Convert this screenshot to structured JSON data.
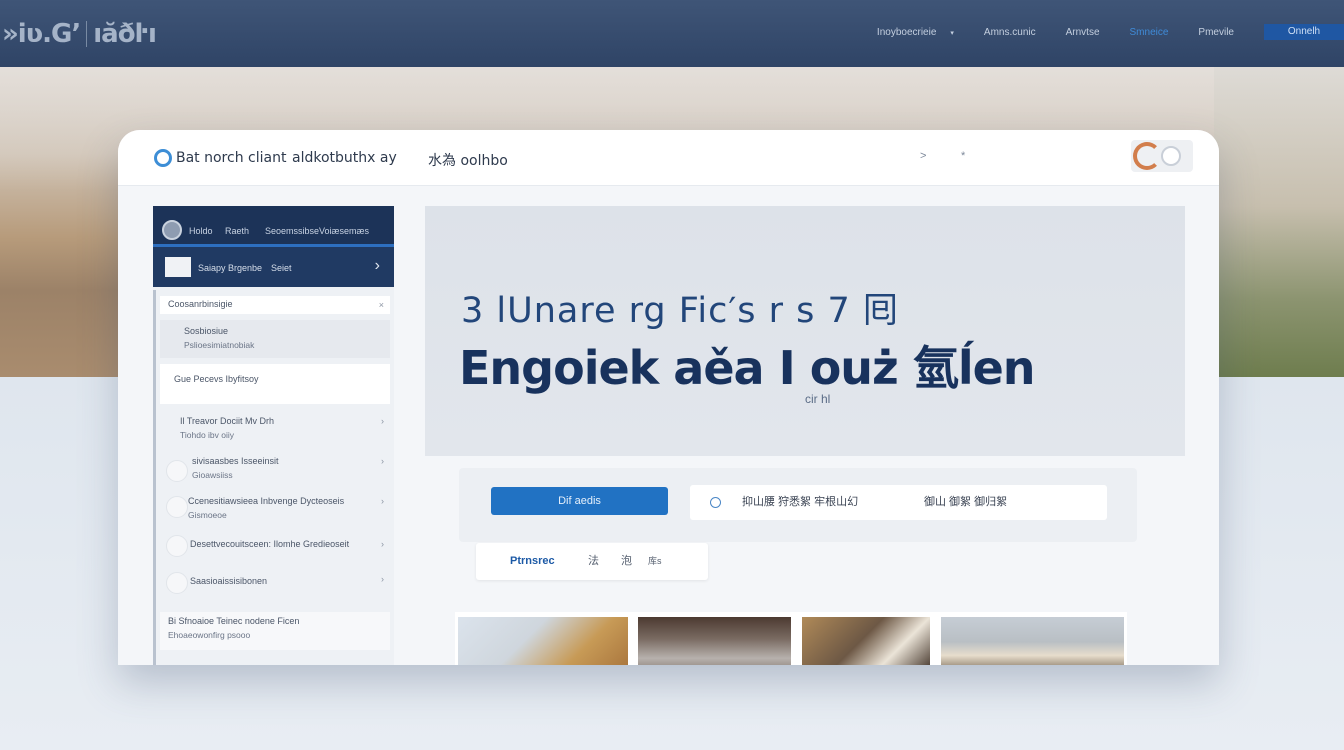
{
  "header": {
    "logo_left": "»iʋ.Gʼ",
    "logo_right": "ıăðŀı",
    "nav": [
      {
        "label": "Inoyboecrieie",
        "active": false
      },
      {
        "label": "Amns.cunic",
        "active": false
      },
      {
        "label": "Arnvtse",
        "active": false
      },
      {
        "label": "Smneice",
        "active": true
      },
      {
        "label": "Pmevile",
        "active": false
      }
    ],
    "cta_label": "Onnelh"
  },
  "browser": {
    "title": "Bat norch cliant",
    "tab1": "aldkotbuthx ay",
    "tab2": "水為 oolhbo",
    "icon1": ">",
    "icon2": "*"
  },
  "sidebar": {
    "head_items": [
      "Holdo",
      "Raeth",
      "Seoemssibse",
      "Voiæsemæs"
    ],
    "sub_items": [
      "Saiapy",
      "Brgenbe",
      "Seiet"
    ],
    "rows": [
      {
        "line1": "Coosanrbinsigie",
        "line2": ""
      },
      {
        "line1": "Sosbiosiue",
        "line2": "Pslioesimiatnobiak"
      },
      {
        "line1": "Gue Pecevs Ibyfitsoy",
        "line2": ""
      },
      {
        "line1": "Il Treavor Dociit Mv Drh",
        "line2": "Tiohdo ibv oiiy"
      },
      {
        "line1": "sivisaasbes Isseeinsit",
        "line2": "Gioawsiiss"
      },
      {
        "line1": "Ccenesitiawsieea Inbvenge Dycteoseis",
        "line2": "Gismoeoe"
      },
      {
        "line1": "Desettvecouitsceen: Ilomhe Gredieoseit",
        "line2": ""
      },
      {
        "line1": "Saasioaissisibonen",
        "line2": ""
      },
      {
        "line1": "Bi Sfnoaioe Teinec nodene Ficen",
        "line2": "Ehoaeowonfirg psooo"
      }
    ]
  },
  "hero": {
    "line1": "3 lUnare rg Fic′s r s 7 囘",
    "line2": "Engoiek aěa I ouż 氫ĺen",
    "sub": "cir hl"
  },
  "search": {
    "button_label": "Dif aedis",
    "input_text": "抑山腰 狩悉絮 牢根山幻",
    "input_text2": "御山 御絮 御归絮"
  },
  "filter": {
    "label": "Ptrnsrec",
    "icon1": "法",
    "icon2": "泡",
    "icon3": "库s"
  },
  "colors": {
    "nav_bg": "#344a6c",
    "accent": "#2172c3",
    "heading": "#18325d"
  }
}
